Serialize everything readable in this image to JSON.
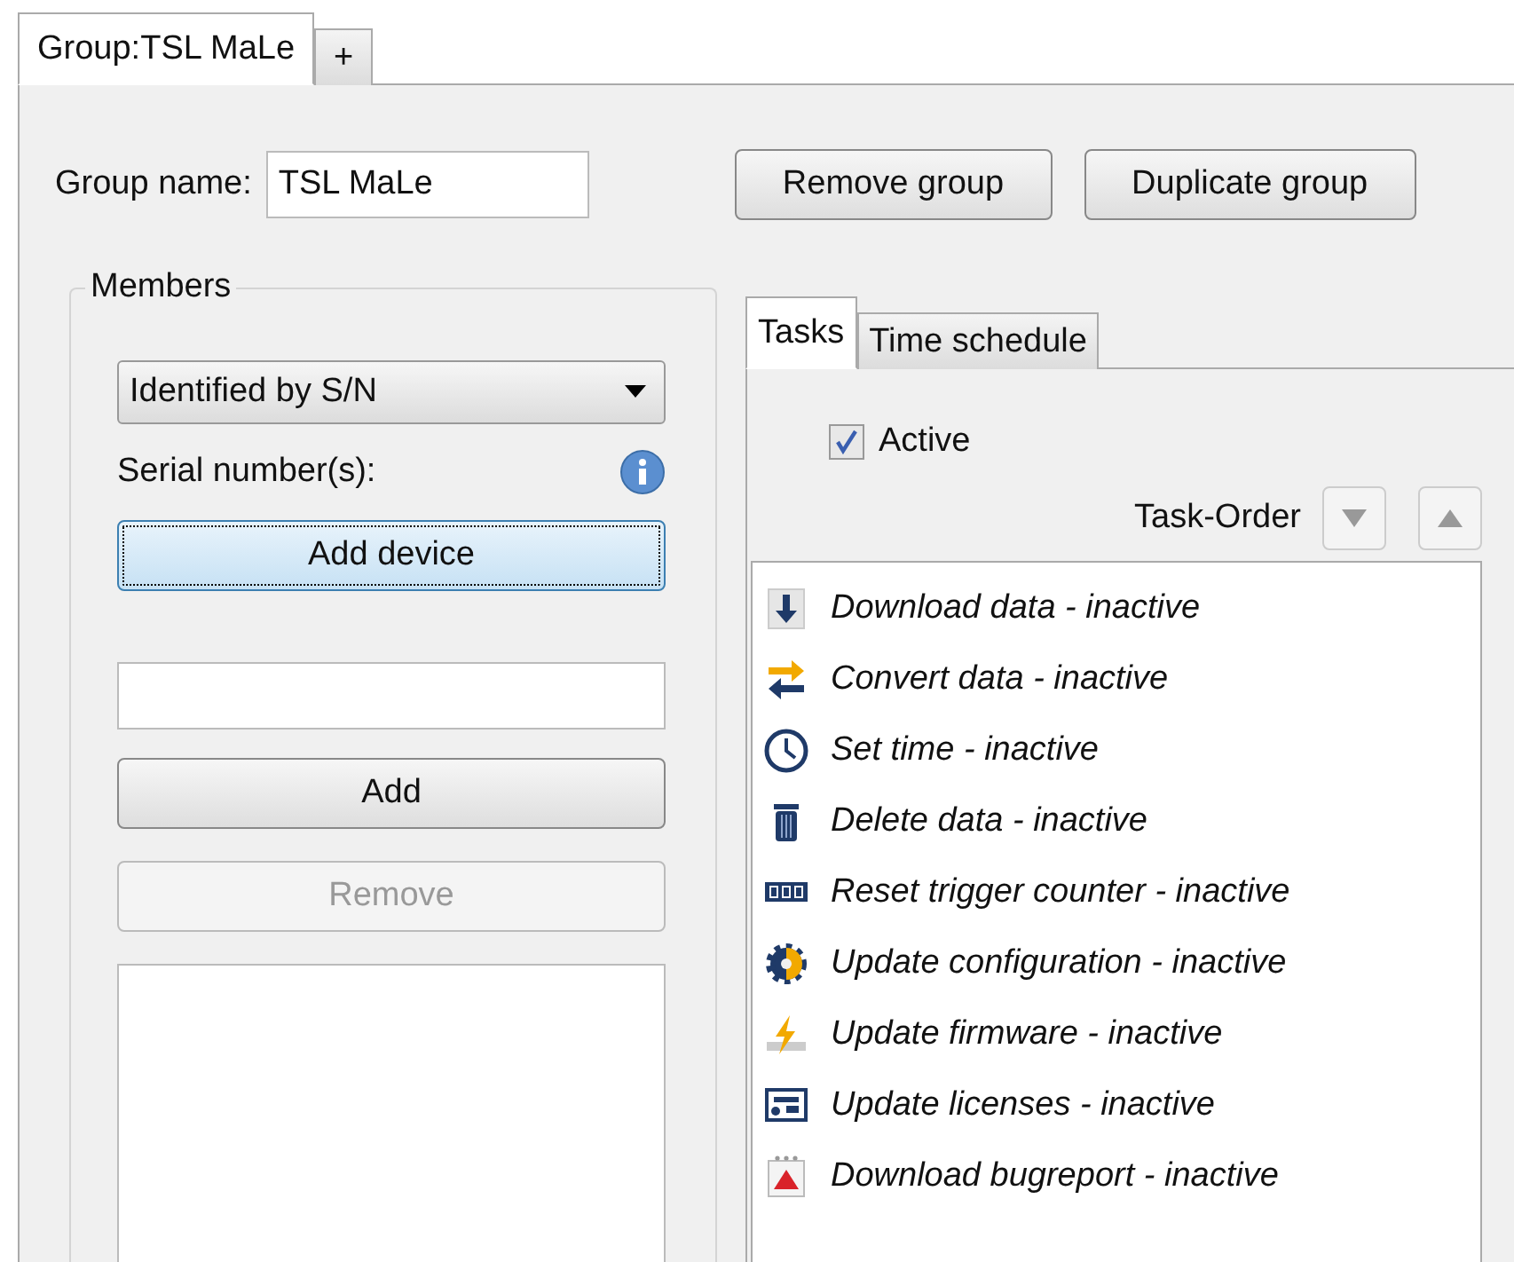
{
  "tabs": [
    {
      "label": "Group:TSL MaLe",
      "selected": true
    },
    {
      "label": "+",
      "selected": false
    }
  ],
  "group_name": {
    "label": "Group name:",
    "value": "TSL MaLe"
  },
  "buttons": [
    {
      "label": "Remove group"
    },
    {
      "label": "Duplicate group"
    }
  ],
  "members": {
    "title": "Members",
    "mode": "Identified by S/N",
    "serial_label": "Serial number(s):",
    "add_device": {
      "label": "Add device",
      "focused": true
    },
    "add": {
      "label": "Add",
      "disabled": false
    },
    "remove": {
      "label": "Remove",
      "disabled": true
    }
  },
  "task_tabs": [
    {
      "label": "Tasks",
      "selected": true
    },
    {
      "label": "Time schedule",
      "selected": false
    }
  ],
  "active": {
    "label": "Active",
    "checked": true
  },
  "task_order": {
    "label": "Task-Order"
  },
  "tasks": [
    {
      "label": "Download data - inactive",
      "kind": "download"
    },
    {
      "label": "Convert data - inactive",
      "kind": "convert"
    },
    {
      "label": "Set time - inactive",
      "kind": "clock"
    },
    {
      "label": "Delete data - inactive",
      "kind": "trash"
    },
    {
      "label": "Reset trigger counter - inactive",
      "kind": "counter"
    },
    {
      "label": "Update configuration - inactive",
      "kind": "gear"
    },
    {
      "label": "Update firmware - inactive",
      "kind": "firmware"
    },
    {
      "label": "Update licenses - inactive",
      "kind": "license"
    },
    {
      "label": "Download bugreport - inactive",
      "kind": "bugreport"
    }
  ]
}
